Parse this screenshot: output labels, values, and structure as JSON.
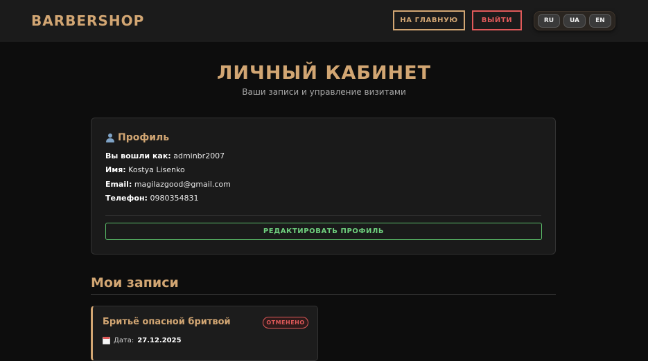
{
  "header": {
    "logo": "BARBERSHOP",
    "home_label": "НА ГЛАВНУЮ",
    "logout_label": "ВЫЙТИ",
    "languages": [
      "RU",
      "UA",
      "EN"
    ]
  },
  "page": {
    "title": "ЛИЧНЫЙ КАБИНЕТ",
    "subtitle": "Ваши записи и управление визитами"
  },
  "profile": {
    "heading": "Профиль",
    "fields": [
      {
        "label": "Вы вошли как:",
        "value": "adminbr2007"
      },
      {
        "label": "Имя:",
        "value": "Kostya Lisenko"
      },
      {
        "label": "Email:",
        "value": "magilazgood@gmail.com"
      },
      {
        "label": "Телефон:",
        "value": "0980354831"
      }
    ],
    "edit_label": "РЕДАКТИРОВАТЬ ПРОФИЛЬ"
  },
  "bookings": {
    "title": "Мои записи",
    "items": [
      {
        "service": "Бритьё опасной бритвой",
        "status": "ОТМЕНЕНО",
        "date_label": "Дата:",
        "date": "27.12.2025"
      }
    ]
  },
  "colors": {
    "accent": "#d2a673",
    "danger": "#e05a5a",
    "success": "#5bbf6a",
    "background": "#0d0d0d"
  },
  "icons": {
    "profile": "user-icon",
    "date": "calendar-icon"
  }
}
